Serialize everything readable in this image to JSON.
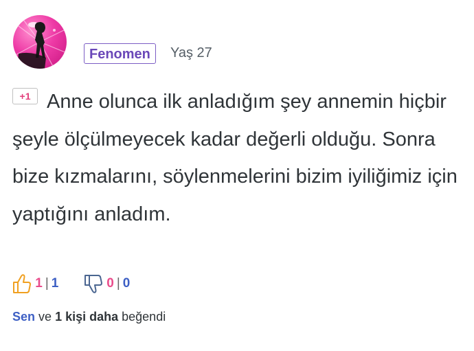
{
  "user": {
    "rank": "Fenomen",
    "age": "Yaş 27"
  },
  "comment": {
    "badge": "+1",
    "text": "Anne olunca ilk anladığım şey annemin hiçbir şeyle ölçülmeyecek kadar değerli olduğu. Sonra bize kızmalarını, söylenmelerini bizim iyiliğimiz için yaptığını anladım."
  },
  "votes": {
    "like": {
      "count": "1",
      "other": "1",
      "icon": "thumbs-up-icon"
    },
    "dislike": {
      "count": "0",
      "other": "0",
      "icon": "thumbs-down-icon"
    },
    "separator": "|"
  },
  "liked_by": {
    "you": "Sen",
    "and": "ve",
    "others": "1 kişi daha",
    "suffix": "beğendi"
  },
  "colors": {
    "rank_border": "#7b5cc4",
    "pink": "#e94c8b",
    "blue": "#3d5fc4",
    "text": "#2f3438"
  }
}
